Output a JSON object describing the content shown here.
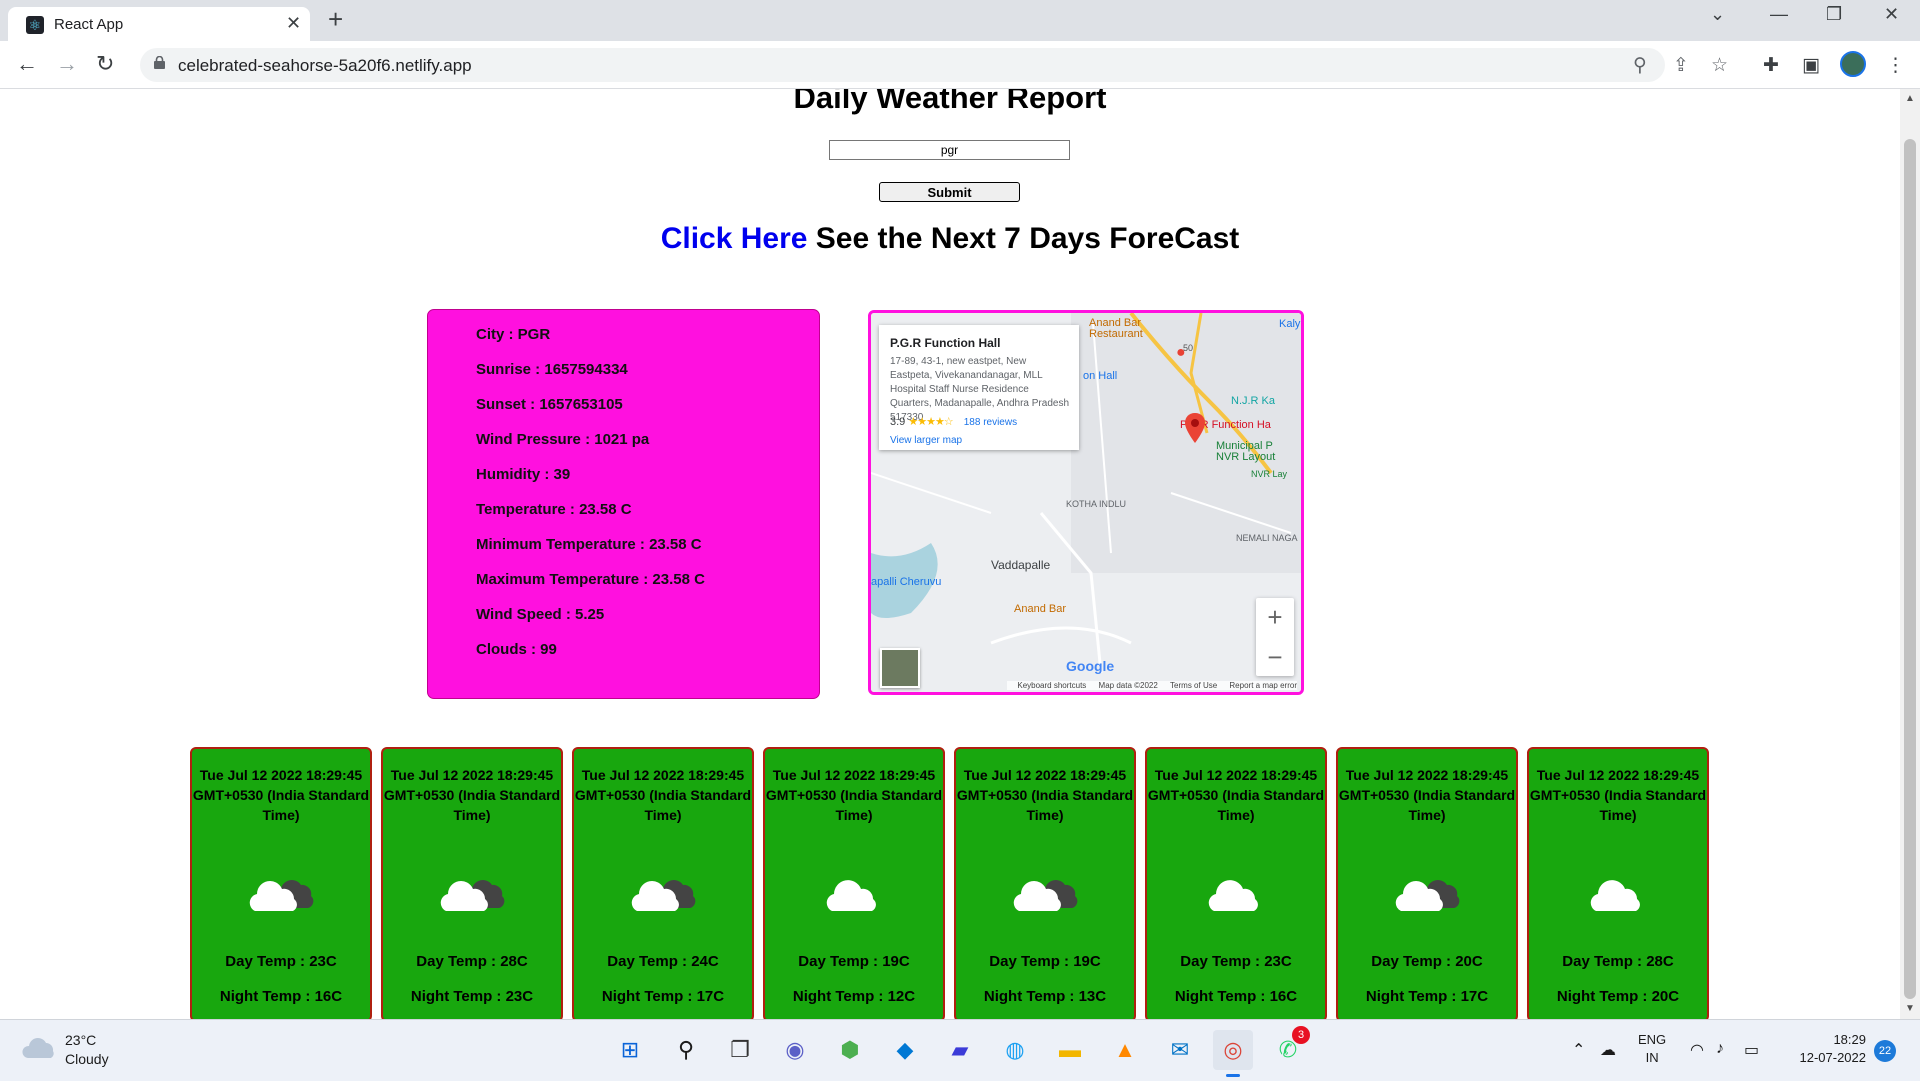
{
  "browser": {
    "tab_title": "React App",
    "url": "celebrated-seahorse-5a20f6.netlify.app",
    "tab_close": "✕",
    "new_tab": "+"
  },
  "page": {
    "title": "Daily Weather Report",
    "city_input_value": "pgr",
    "submit_label": "Submit",
    "forecast_link": "Click Here",
    "forecast_text": " See the Next 7 Days ForeCast"
  },
  "current": {
    "lines": [
      "City : PGR",
      "Sunrise : 1657594334",
      "Sunset : 1657653105",
      "Wind Pressure : 1021 pa",
      "Humidity : 39",
      "Temperature : 23.58 C",
      "Minimum Temperature : 23.58 C",
      "Maximum Temperature : 23.58 C",
      "Wind Speed : 5.25",
      "Clouds : 99"
    ]
  },
  "map": {
    "place_name": "P.G.R Function Hall",
    "address": "17-89, 43-1, new eastpet, New Eastpeta, Vivekanandanagar, MLL Hospital Staff Nurse Residence Quarters, Madanapalle, Andhra Pradesh 517330",
    "rating": "3.9",
    "stars": "★★★★☆",
    "reviews": "188 reviews",
    "larger_map": "View larger map",
    "labels": {
      "anand_bar_top": "Anand Bar\nRestaurant",
      "hall_partial": "on Hall",
      "njr": "N.J.R Ka",
      "pgr_pin": "P.G.R Function Ha",
      "municipal": "Municipal P\nNVR Layout",
      "nvr_lay": "NVR Lay",
      "kotha_indlu": "KOTHA INDLU",
      "nemali_naga": "NEMALI NAGA",
      "vaddapalle": "Vaddapalle",
      "cheruvu": "apalli Cheruvu",
      "anand_bar": "Anand Bar",
      "kaly": "Kaly",
      "road_50": "50"
    },
    "google": "Google",
    "footer": [
      "Keyboard shortcuts",
      "Map data ©2022",
      "Terms of Use",
      "Report a map error"
    ],
    "zoom_in": "+",
    "zoom_out": "−"
  },
  "forecast": [
    {
      "date": "Tue Jul 12 2022 18:29:45 GMT+0530 (India Standard Time)",
      "icon": "partly-cloudy-dark",
      "day": "Day Temp : 23C",
      "night": "Night Temp : 16C"
    },
    {
      "date": "Tue Jul 12 2022 18:29:45 GMT+0530 (India Standard Time)",
      "icon": "partly-cloudy-dark",
      "day": "Day Temp : 28C",
      "night": "Night Temp : 23C"
    },
    {
      "date": "Tue Jul 12 2022 18:29:45 GMT+0530 (India Standard Time)",
      "icon": "partly-cloudy-dark",
      "day": "Day Temp : 24C",
      "night": "Night Temp : 17C"
    },
    {
      "date": "Tue Jul 12 2022 18:29:45 GMT+0530 (India Standard Time)",
      "icon": "cloud",
      "day": "Day Temp : 19C",
      "night": "Night Temp : 12C"
    },
    {
      "date": "Tue Jul 12 2022 18:29:45 GMT+0530 (India Standard Time)",
      "icon": "partly-cloudy-dark",
      "day": "Day Temp : 19C",
      "night": "Night Temp : 13C"
    },
    {
      "date": "Tue Jul 12 2022 18:29:45 GMT+0530 (India Standard Time)",
      "icon": "cloud",
      "day": "Day Temp : 23C",
      "night": "Night Temp : 16C"
    },
    {
      "date": "Tue Jul 12 2022 18:29:45 GMT+0530 (India Standard Time)",
      "icon": "partly-cloudy-dark",
      "day": "Day Temp : 20C",
      "night": "Night Temp : 17C"
    },
    {
      "date": "Tue Jul 12 2022 18:29:45 GMT+0530 (India Standard Time)",
      "icon": "cloud",
      "day": "Day Temp : 28C",
      "night": "Night Temp : 20C"
    }
  ],
  "taskbar": {
    "weather_temp": "23°C",
    "weather_cond": "Cloudy",
    "lang_1": "ENG",
    "lang_2": "IN",
    "time": "18:29",
    "date": "12-07-2022",
    "notifications": "22",
    "whatsapp_badge": "3"
  },
  "colors": {
    "info_card": "#ff10df",
    "forecast_card": "#18a70e",
    "link": "#0000ee"
  }
}
